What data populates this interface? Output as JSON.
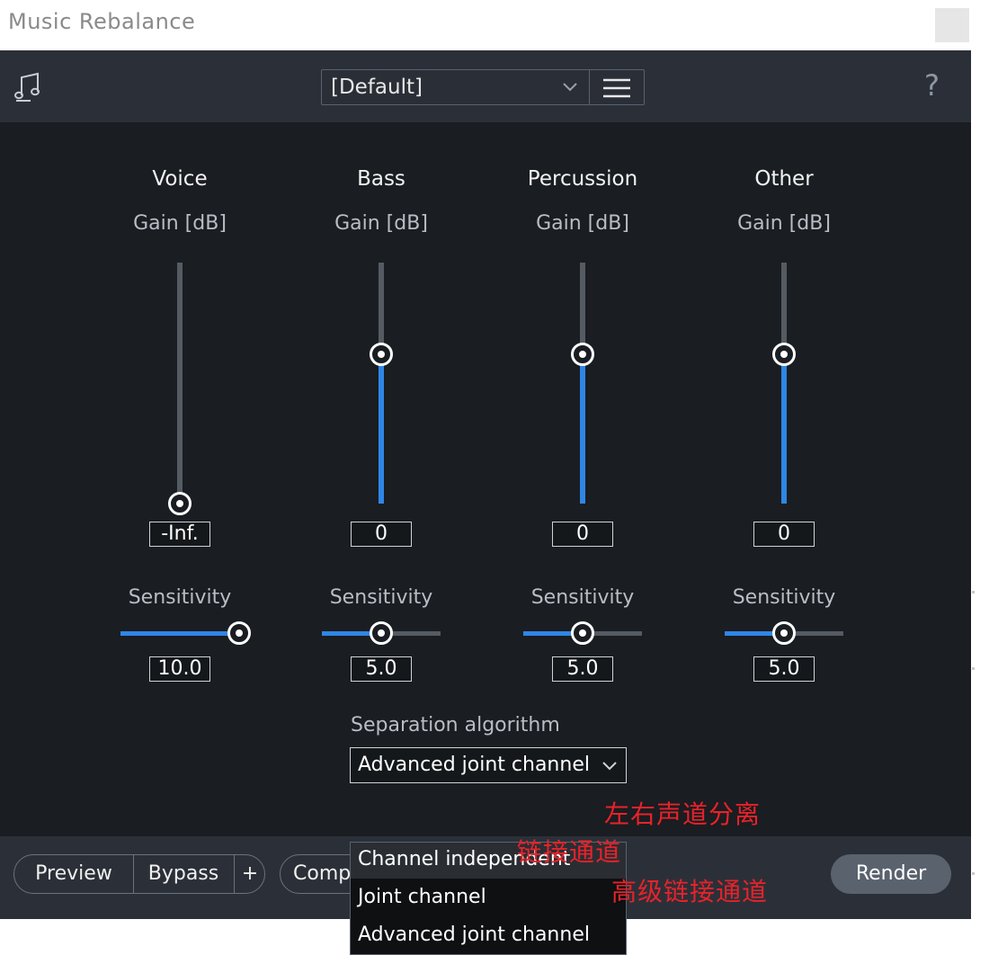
{
  "window": {
    "title": "Music Rebalance"
  },
  "header": {
    "preset_value": "[Default]",
    "icons": {
      "logo": "music-note-icon",
      "preset_menu": "hamburger-menu-icon",
      "help": "help-icon"
    },
    "help_glyph": "?"
  },
  "channels": [
    {
      "name": "Voice",
      "gain_label": "Gain [dB]",
      "gain_value": "-Inf.",
      "gain_fill_fraction": 0.0,
      "sensitivity_label": "Sensitivity",
      "sensitivity_value": "10.0",
      "sensitivity_fraction": 1.0
    },
    {
      "name": "Bass",
      "gain_label": "Gain [dB]",
      "gain_value": "0",
      "gain_fill_fraction": 0.62,
      "sensitivity_label": "Sensitivity",
      "sensitivity_value": "5.0",
      "sensitivity_fraction": 0.5
    },
    {
      "name": "Percussion",
      "gain_label": "Gain [dB]",
      "gain_value": "0",
      "gain_fill_fraction": 0.62,
      "sensitivity_label": "Sensitivity",
      "sensitivity_value": "5.0",
      "sensitivity_fraction": 0.5
    },
    {
      "name": "Other",
      "gain_label": "Gain [dB]",
      "gain_value": "0",
      "gain_fill_fraction": 0.62,
      "sensitivity_label": "Sensitivity",
      "sensitivity_value": "5.0",
      "sensitivity_fraction": 0.5
    }
  ],
  "separation": {
    "label": "Separation algorithm",
    "selected": "Advanced joint channel",
    "options": [
      {
        "label": "Channel independent",
        "annotation": "左右声道分离"
      },
      {
        "label": "Joint channel",
        "annotation": "链接通道"
      },
      {
        "label": "Advanced joint channel",
        "annotation": "高级链接通道"
      }
    ]
  },
  "footer": {
    "preview_label": "Preview",
    "bypass_label": "Bypass",
    "add_label": "+",
    "compare_label": "Comp",
    "render_label": "Render"
  },
  "colors": {
    "accent": "#2f86e6",
    "background": "#1a1d21",
    "header": "#2b3038",
    "annotation": "#e8222a"
  }
}
